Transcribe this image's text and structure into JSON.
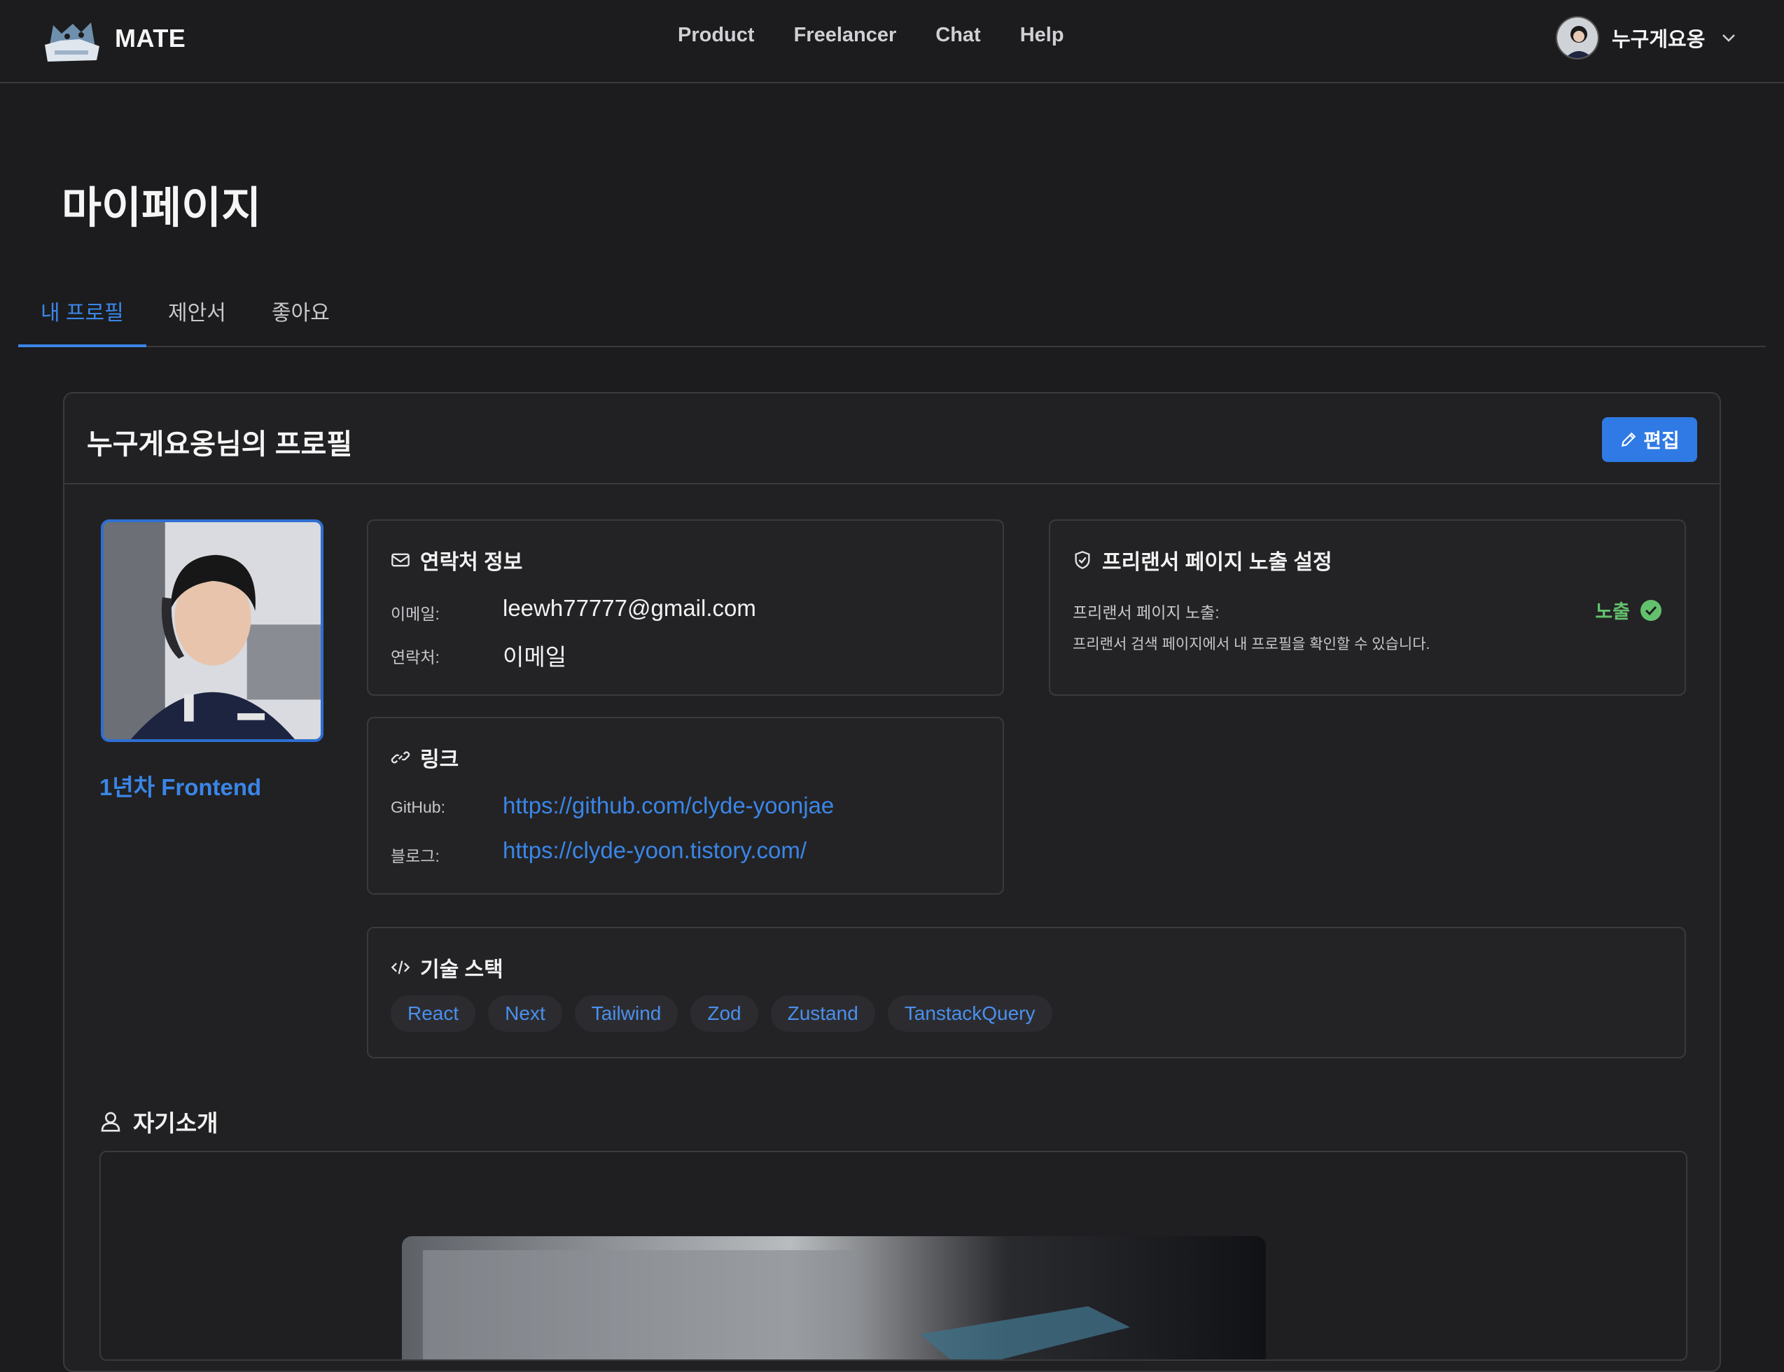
{
  "header": {
    "brand": "MATE",
    "nav": [
      "Product",
      "Freelancer",
      "Chat",
      "Help"
    ],
    "user_name": "누구게요옹"
  },
  "page": {
    "title": "마이페이지",
    "tabs": [
      "내 프로필",
      "제안서",
      "좋아요"
    ]
  },
  "profile": {
    "title": "누구게요옹님의 프로필",
    "edit_label": "편집",
    "experience": "1년차 Frontend",
    "contact": {
      "title": "연락처 정보",
      "email_label": "이메일:",
      "email_value": "leewh77777@gmail.com",
      "phone_label": "연락처:",
      "phone_value": "이메일"
    },
    "links": {
      "title": "링크",
      "github_label": "GitHub:",
      "github_value": "https://github.com/clyde-yoonjae",
      "blog_label": "블로그:",
      "blog_value": "https://clyde-yoon.tistory.com/"
    },
    "freelancer": {
      "title": "프리랜서 페이지 노출 설정",
      "label": "프리랜서 페이지 노출:",
      "status": "노출",
      "description": "프리랜서 검색 페이지에서 내 프로필을 확인할 수 있습니다."
    },
    "skills": {
      "title": "기술 스택",
      "items": [
        "React",
        "Next",
        "Tailwind",
        "Zod",
        "Zustand",
        "TanstackQuery"
      ]
    },
    "intro": {
      "title": "자기소개"
    }
  },
  "colors": {
    "accent": "#2f7ae5",
    "link": "#3a86e8",
    "success": "#63c16d",
    "background": "#1c1c1e"
  }
}
